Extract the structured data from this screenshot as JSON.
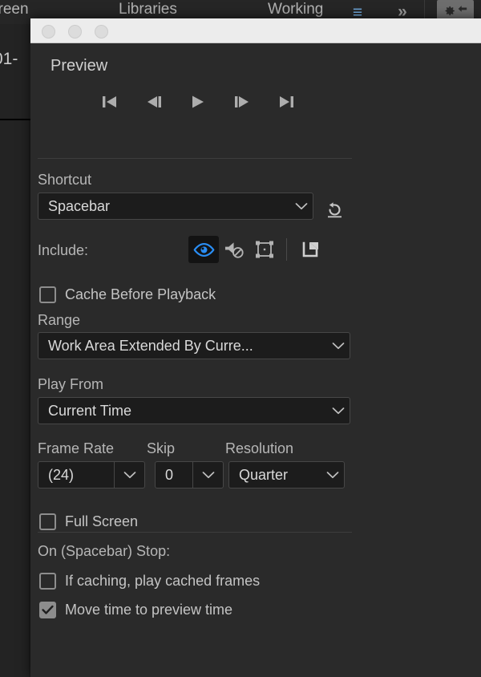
{
  "background": {
    "tabs": [
      {
        "label": "creen",
        "name": "bg-tab-screen"
      },
      {
        "label": "Libraries",
        "name": "bg-tab-libraries"
      },
      {
        "label": "Working",
        "name": "bg-tab-working"
      }
    ],
    "menu_icon": "≡",
    "overflow_icon": "»",
    "gear_icon": "gear-icon",
    "panel_label": "01-",
    "accent_color": "#3f8fdf"
  },
  "window": {
    "controls": {
      "close": "close-button",
      "minimize": "minimize-button",
      "maximize": "maximize-button"
    }
  },
  "panel": {
    "title": "Preview",
    "transport": [
      {
        "name": "first-frame-button",
        "icon": "skip-to-start-icon"
      },
      {
        "name": "previous-frame-button",
        "icon": "step-backward-icon"
      },
      {
        "name": "play-button",
        "icon": "play-icon"
      },
      {
        "name": "next-frame-button",
        "icon": "step-forward-icon"
      },
      {
        "name": "last-frame-button",
        "icon": "skip-to-end-icon"
      }
    ],
    "shortcut": {
      "label": "Shortcut",
      "value": "Spacebar",
      "revert_icon": "revert-icon"
    },
    "include": {
      "label": "Include:",
      "toggles": [
        {
          "name": "include-video-toggle",
          "icon": "eye-icon",
          "active": true
        },
        {
          "name": "include-audio-toggle",
          "icon": "speaker-muted-icon",
          "active": false
        },
        {
          "name": "include-overlays-toggle",
          "icon": "layer-bounds-icon",
          "active": false
        }
      ],
      "export_icon": "share-export-icon"
    },
    "cache_before_playback": {
      "label": "Cache Before Playback",
      "checked": false
    },
    "range": {
      "label": "Range",
      "value": "Work Area Extended By Curre..."
    },
    "play_from": {
      "label": "Play From",
      "value": "Current Time"
    },
    "frame_rate": {
      "label": "Frame Rate",
      "value": "(24)"
    },
    "skip": {
      "label": "Skip",
      "value": "0"
    },
    "resolution": {
      "label": "Resolution",
      "value": "Quarter"
    },
    "full_screen": {
      "label": "Full Screen",
      "checked": false
    },
    "on_stop": {
      "label": "On (Spacebar) Stop:",
      "options": [
        {
          "label": "If caching, play cached frames",
          "checked": false,
          "name": "if-caching-play-cached-frames-checkbox"
        },
        {
          "label": "Move time to preview time",
          "checked": true,
          "name": "move-time-to-preview-time-checkbox"
        }
      ]
    }
  }
}
